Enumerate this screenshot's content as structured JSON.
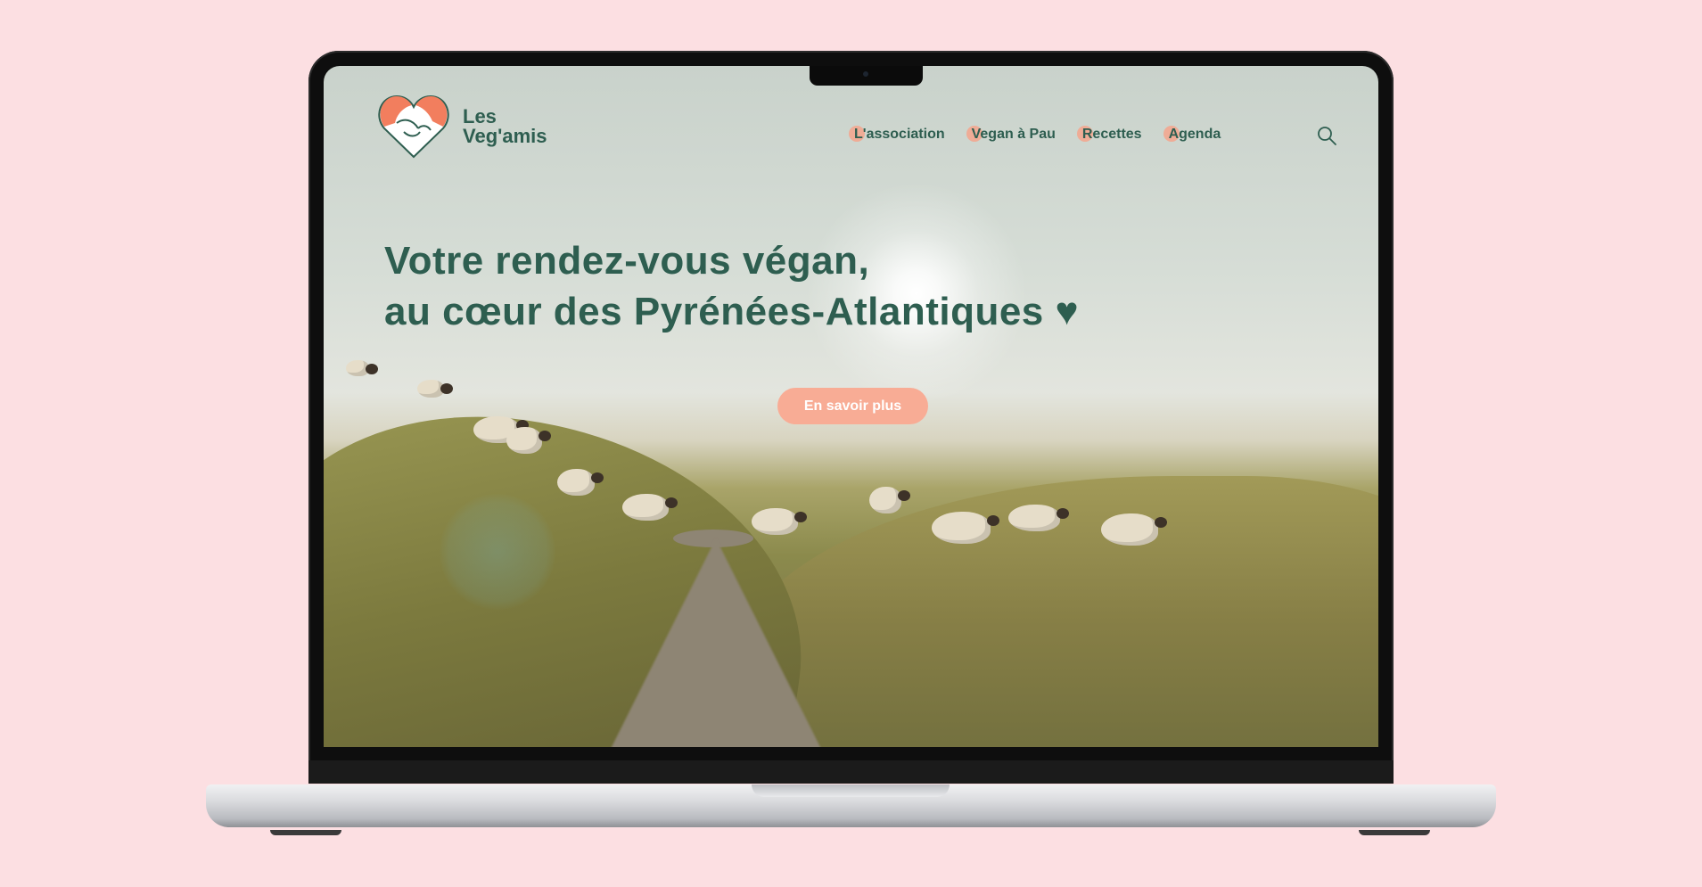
{
  "site": {
    "logo_line1": "Les",
    "logo_line2": "Veg'amis",
    "brand_colors": {
      "green": "#2e5e50",
      "coral": "#f8ac95",
      "background": "#fcdfe2"
    }
  },
  "nav": {
    "items": [
      {
        "label": "L'association"
      },
      {
        "label": "Vegan à Pau"
      },
      {
        "label": "Recettes"
      },
      {
        "label": "Agenda"
      }
    ],
    "search_icon": "search-icon"
  },
  "hero": {
    "title_line1": "Votre rendez-vous végan,",
    "title_line2": "au cœur des Pyrénées-Atlantiques ♥",
    "cta_label": "En savoir plus"
  }
}
